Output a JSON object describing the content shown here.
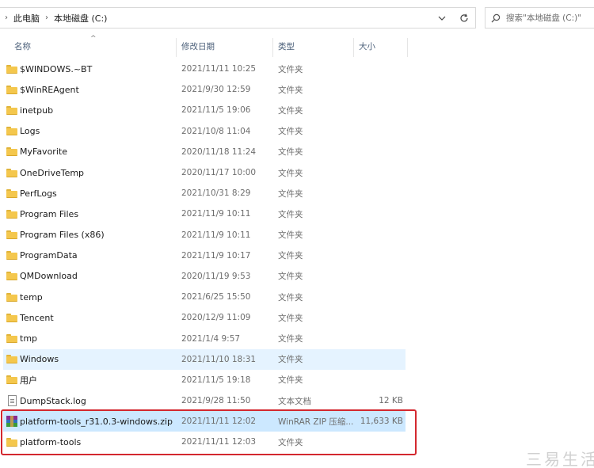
{
  "address": {
    "crumbs": [
      "此电脑",
      "本地磁盘 (C:)"
    ]
  },
  "search": {
    "placeholder": "搜索\"本地磁盘 (C:)\""
  },
  "columns": {
    "name": "名称",
    "date": "修改日期",
    "type": "类型",
    "size": "大小"
  },
  "rows": [
    {
      "name": "$WINDOWS.~BT",
      "date": "2021/11/11 10:25",
      "type": "文件夹",
      "size": "",
      "icon": "folder-icon"
    },
    {
      "name": "$WinREAgent",
      "date": "2021/9/30 12:59",
      "type": "文件夹",
      "size": "",
      "icon": "folder-icon"
    },
    {
      "name": "inetpub",
      "date": "2021/11/5 19:06",
      "type": "文件夹",
      "size": "",
      "icon": "folder-icon"
    },
    {
      "name": "Logs",
      "date": "2021/10/8 11:04",
      "type": "文件夹",
      "size": "",
      "icon": "folder-icon"
    },
    {
      "name": "MyFavorite",
      "date": "2020/11/18 11:24",
      "type": "文件夹",
      "size": "",
      "icon": "folder-icon"
    },
    {
      "name": "OneDriveTemp",
      "date": "2020/11/17 10:00",
      "type": "文件夹",
      "size": "",
      "icon": "folder-icon"
    },
    {
      "name": "PerfLogs",
      "date": "2021/10/31 8:29",
      "type": "文件夹",
      "size": "",
      "icon": "folder-icon"
    },
    {
      "name": "Program Files",
      "date": "2021/11/9 10:11",
      "type": "文件夹",
      "size": "",
      "icon": "folder-icon"
    },
    {
      "name": "Program Files (x86)",
      "date": "2021/11/9 10:11",
      "type": "文件夹",
      "size": "",
      "icon": "folder-icon"
    },
    {
      "name": "ProgramData",
      "date": "2021/11/9 10:17",
      "type": "文件夹",
      "size": "",
      "icon": "folder-icon"
    },
    {
      "name": "QMDownload",
      "date": "2020/11/19 9:53",
      "type": "文件夹",
      "size": "",
      "icon": "folder-icon"
    },
    {
      "name": "temp",
      "date": "2021/6/25 15:50",
      "type": "文件夹",
      "size": "",
      "icon": "folder-icon"
    },
    {
      "name": "Tencent",
      "date": "2020/12/9 11:09",
      "type": "文件夹",
      "size": "",
      "icon": "folder-icon"
    },
    {
      "name": "tmp",
      "date": "2021/1/4 9:57",
      "type": "文件夹",
      "size": "",
      "icon": "folder-icon"
    },
    {
      "name": "Windows",
      "date": "2021/11/10 18:31",
      "type": "文件夹",
      "size": "",
      "icon": "folder-icon",
      "state": "hover"
    },
    {
      "name": "用户",
      "date": "2021/11/5 19:18",
      "type": "文件夹",
      "size": "",
      "icon": "folder-icon"
    },
    {
      "name": "DumpStack.log",
      "date": "2021/9/28 11:50",
      "type": "文本文档",
      "size": "12 KB",
      "icon": "text-file-icon"
    },
    {
      "name": "platform-tools_r31.0.3-windows.zip",
      "date": "2021/11/11 12:02",
      "type": "WinRAR ZIP 压缩...",
      "size": "11,633 KB",
      "icon": "winrar-archive-icon",
      "state": "selected"
    },
    {
      "name": "platform-tools",
      "date": "2021/11/11 12:03",
      "type": "文件夹",
      "size": "",
      "icon": "folder-icon"
    }
  ],
  "watermark": "三易生活",
  "colors": {
    "hover": "#e5f3ff",
    "selected": "#cce8ff",
    "highlight_box": "#d3282f",
    "folder": "#f4c74d"
  }
}
